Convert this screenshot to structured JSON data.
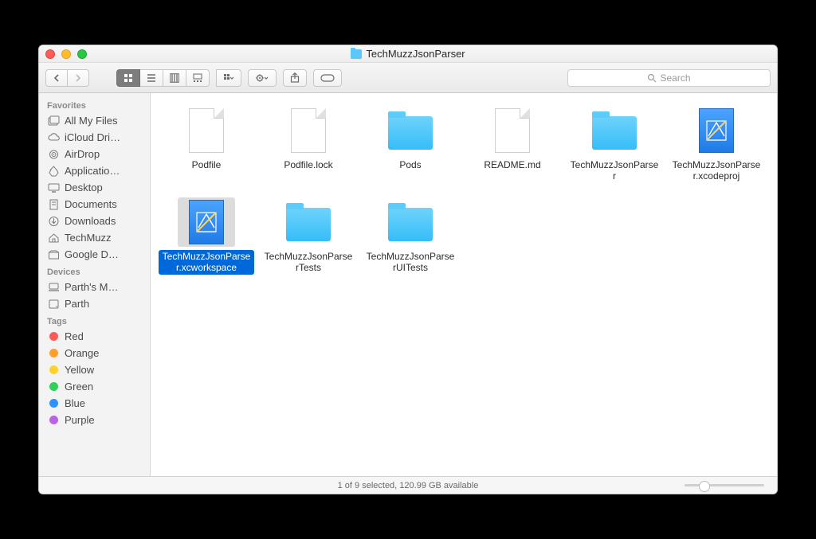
{
  "window": {
    "title": "TechMuzzJsonParser"
  },
  "search": {
    "placeholder": "Search"
  },
  "sidebar": {
    "sections": [
      {
        "header": "Favorites",
        "items": [
          {
            "label": "All My Files",
            "icon": "all-files"
          },
          {
            "label": "iCloud Dri…",
            "icon": "cloud"
          },
          {
            "label": "AirDrop",
            "icon": "airdrop"
          },
          {
            "label": "Applicatio…",
            "icon": "apps"
          },
          {
            "label": "Desktop",
            "icon": "desktop"
          },
          {
            "label": "Documents",
            "icon": "docs"
          },
          {
            "label": "Downloads",
            "icon": "downloads"
          },
          {
            "label": "TechMuzz",
            "icon": "home"
          },
          {
            "label": "Google D…",
            "icon": "gdrive"
          }
        ]
      },
      {
        "header": "Devices",
        "items": [
          {
            "label": "Parth's M…",
            "icon": "laptop"
          },
          {
            "label": "Parth",
            "icon": "disk"
          }
        ]
      },
      {
        "header": "Tags",
        "items": [
          {
            "label": "Red",
            "icon": "tag",
            "color": "#ff5b56"
          },
          {
            "label": "Orange",
            "icon": "tag",
            "color": "#ff9e2d"
          },
          {
            "label": "Yellow",
            "icon": "tag",
            "color": "#ffd22e"
          },
          {
            "label": "Green",
            "icon": "tag",
            "color": "#30d158"
          },
          {
            "label": "Blue",
            "icon": "tag",
            "color": "#2f90ff"
          },
          {
            "label": "Purple",
            "icon": "tag",
            "color": "#b864e6"
          }
        ]
      }
    ]
  },
  "files": [
    {
      "name": "Podfile",
      "type": "file",
      "selected": false
    },
    {
      "name": "Podfile.lock",
      "type": "file",
      "selected": false
    },
    {
      "name": "Pods",
      "type": "folder",
      "selected": false
    },
    {
      "name": "README.md",
      "type": "file",
      "selected": false
    },
    {
      "name": "TechMuzzJsonParser",
      "type": "folder",
      "selected": false
    },
    {
      "name": "TechMuzzJsonParser.xcodeproj",
      "type": "xcode",
      "selected": false
    },
    {
      "name": "TechMuzzJsonParser.xcworkspace",
      "type": "xcode",
      "selected": true
    },
    {
      "name": "TechMuzzJsonParserTests",
      "type": "folder",
      "selected": false
    },
    {
      "name": "TechMuzzJsonParserUITests",
      "type": "folder",
      "selected": false
    }
  ],
  "status": {
    "text": "1 of 9 selected, 120.99 GB available"
  }
}
